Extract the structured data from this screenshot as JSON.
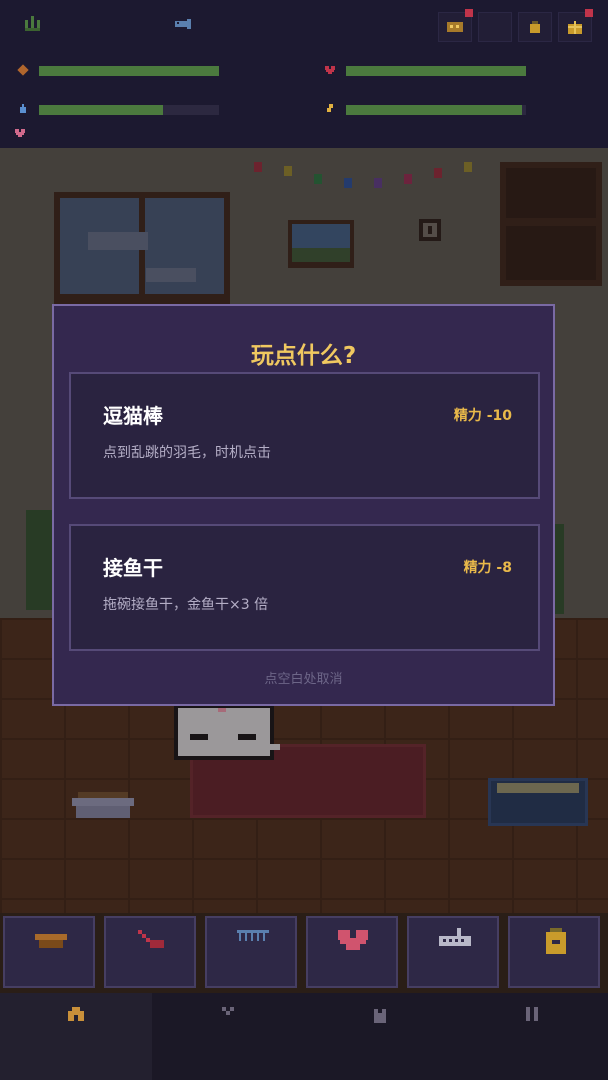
{
  "hud": {
    "top_icons": [
      "grass-icon",
      "fish-icon"
    ],
    "top_buttons": [
      "coin-chest-icon",
      "empty-slot-icon",
      "potion-icon",
      "gift-icon"
    ],
    "stats": [
      {
        "icon": "food-icon",
        "level": 1.0,
        "color": "#4b7a3e"
      },
      {
        "icon": "heart-icon",
        "level": 1.0,
        "color": "#4b7a3e"
      },
      {
        "icon": "water-drop-icon",
        "level": 0.69,
        "color": "#4b7a3e"
      },
      {
        "icon": "energy-icon",
        "level": 0.98,
        "color": "#4b7a3e"
      }
    ],
    "extra_icon": "pink-heart-icon"
  },
  "modal": {
    "title": "玩点什么?",
    "options": [
      {
        "name": "逗猫棒",
        "cost": "精力 -10",
        "description": "点到乱跳的羽毛，时机点击"
      },
      {
        "name": "接鱼干",
        "cost": "精力 -8",
        "description": "拖碗接鱼干，金鱼干×3 倍"
      }
    ],
    "cancel_hint": "点空白处取消"
  },
  "toolbar": {
    "items": [
      "food-bowl-icon",
      "broom-icon",
      "comb-icon",
      "heart-icon",
      "keyboard-toy-icon",
      "jar-icon"
    ]
  },
  "nav": {
    "items": [
      "home-icon",
      "chevron-down-icon",
      "cat-icon",
      "pause-icon"
    ],
    "active": 0
  },
  "colors": {
    "accent": "#f0c860",
    "cost": "#e9b94a",
    "modal_bg": "#34284f",
    "bar_fill": "#4b7a3e"
  }
}
